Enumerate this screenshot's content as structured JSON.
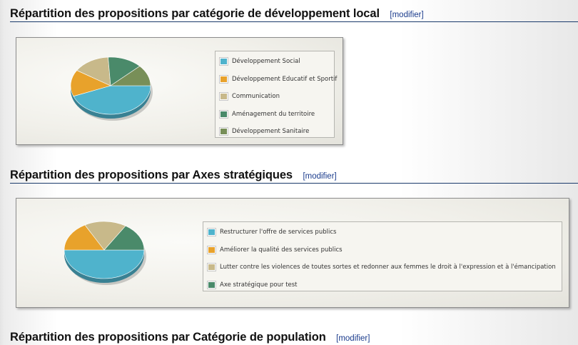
{
  "colors": {
    "bg": "#ffffff",
    "header_rule": "#1a3a6b",
    "link": "#1a3b8c",
    "panel_border": "#8c8c8c"
  },
  "sections": [
    {
      "title": "Répartition des propositions par catégorie de développement local",
      "edit_label": "[modifier]"
    },
    {
      "title": "Répartition des propositions par Axes stratégiques",
      "edit_label": "[modifier]"
    },
    {
      "title": "Répartition des propositions par Catégorie de population",
      "edit_label": "[modifier]"
    }
  ],
  "chart_data": [
    {
      "type": "pie",
      "series": [
        {
          "name": "Développement Social",
          "value": 44,
          "color": "#4fb3cc"
        },
        {
          "name": "Développement Educatif et Sportif",
          "value": 15,
          "color": "#e8a22b"
        },
        {
          "name": "Communication",
          "value": 15,
          "color": "#c8b98a"
        },
        {
          "name": "Aménagement du territoire",
          "value": 14,
          "color": "#4a8a6a"
        },
        {
          "name": "Développement Sanitaire",
          "value": 12,
          "color": "#788f58"
        }
      ],
      "legend": "right"
    },
    {
      "type": "pie",
      "series": [
        {
          "name": "Restructurer l'offre de services publics",
          "value": 50,
          "color": "#4fb3cc"
        },
        {
          "name": "Améliorer la qualité des services publics",
          "value": 17,
          "color": "#e8a22b"
        },
        {
          "name": "Lutter contre les violences de toutes sortes et redonner aux femmes le droit à l'expression et à l'émancipation",
          "value": 17,
          "color": "#c8b98a"
        },
        {
          "name": "Axe stratégique pour test",
          "value": 16,
          "color": "#4a8a6a"
        }
      ],
      "legend": "right"
    }
  ]
}
